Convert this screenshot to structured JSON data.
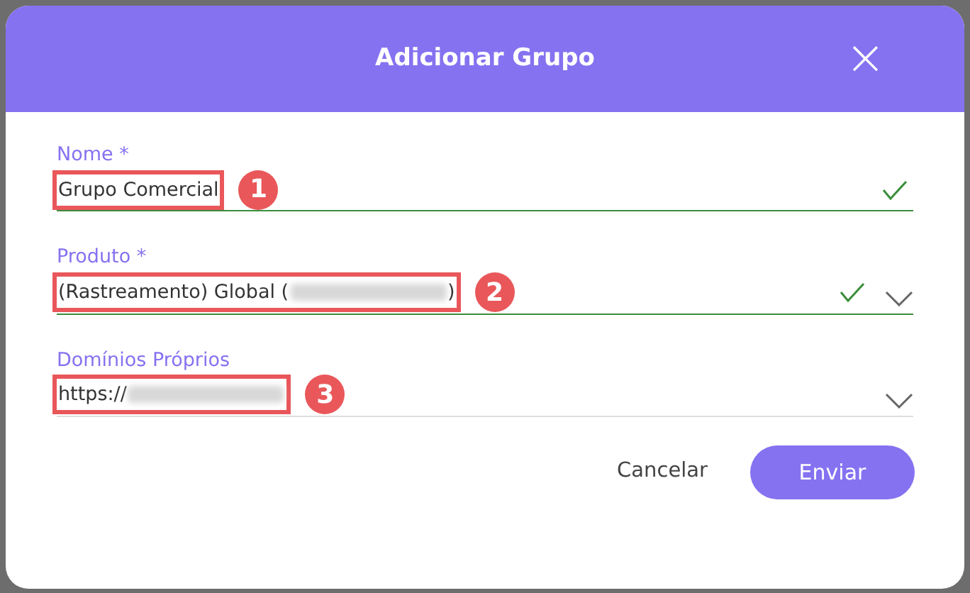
{
  "dialog": {
    "title": "Adicionar Grupo",
    "close": "×"
  },
  "fields": [
    {
      "kind": "text",
      "label": "Nome *",
      "value": "Grupo Comercial",
      "redacted": false,
      "valid": true,
      "callout": "1"
    },
    {
      "kind": "select",
      "label": "Produto *",
      "value": "(Rastreamento) Global (",
      "redacted": true,
      "value_end": ")",
      "valid": true,
      "callout": "2"
    },
    {
      "kind": "select",
      "label": "Domínios Próprios",
      "value": "https://",
      "redacted": true,
      "valid": false,
      "callout": "3"
    }
  ],
  "buttons": [
    {
      "label": "Cancelar",
      "kind": "text"
    },
    {
      "label": "Enviar",
      "kind": "primary"
    }
  ]
}
